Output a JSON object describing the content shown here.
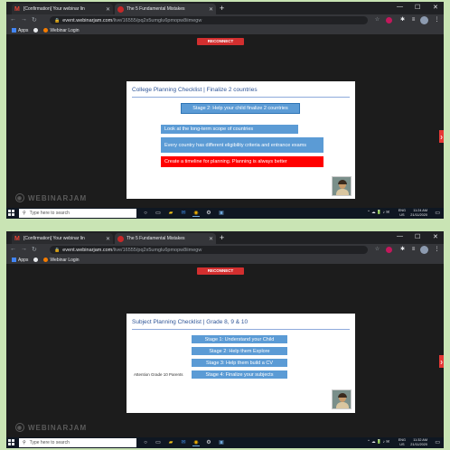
{
  "colors": {
    "page_bg": "#c9e4b4",
    "slide_title": "#2f5597",
    "bar_blue": "#5b9bd5",
    "bar_red": "#ff0000",
    "reconnect": "#d32f2f"
  },
  "screens": [
    {
      "tabs": [
        {
          "label": "[Confirmation] Your webinar lin",
          "icon": "gmail-icon"
        },
        {
          "label": "The 5 Fundamental Mistakes",
          "icon": "webinarjam-icon"
        }
      ],
      "new_tab": "+",
      "url_host": "event.webinarjam.com",
      "url_path": "/live/16555/pq2x5umglu6pmopw8iimegw",
      "bookmarks": [
        {
          "label": "Apps"
        },
        {
          "label": ""
        },
        {
          "label": "Webinar Login"
        }
      ],
      "reconnect": "RECONNECT",
      "slide": {
        "title": "College Planning Checklist | Finalize 2 countries",
        "stage": "Stage 2: Help your child finalize 2 countries",
        "items": [
          "Look at the long-term scope of countries",
          "Every country has different eligibility criteria and entrance exams",
          "Create a timeline for planning. Planning is always better"
        ]
      },
      "watermark": "WEBINARJAM",
      "taskbar": {
        "search_placeholder": "Type here to search",
        "lang_top": "ENG",
        "lang_bottom": "US",
        "time": "11:24 AM",
        "date": "21/11/2020"
      }
    },
    {
      "tabs": [
        {
          "label": "[Confirmation] Your webinar lin",
          "icon": "gmail-icon"
        },
        {
          "label": "The 5 Fundamental Mistakes",
          "icon": "webinarjam-icon"
        }
      ],
      "new_tab": "+",
      "url_host": "event.webinarjam.com",
      "url_path": "/live/16555/pq2x5umglu6pmopw8iimegw",
      "bookmarks": [
        {
          "label": "Apps"
        },
        {
          "label": ""
        },
        {
          "label": "Webinar Login"
        }
      ],
      "reconnect": "RECONNECT",
      "slide": {
        "title": "Subject Planning Checklist | Grade 8, 9 & 10",
        "stages": [
          "Stage 1: Understand your Child",
          "Stage 2: Help them Explore",
          "Stage 3: Help them build a CV",
          "Stage 4: Finalize your subjects"
        ],
        "side_note": "Attention Grade 10 Parents"
      },
      "watermark": "WEBINARJAM",
      "taskbar": {
        "search_placeholder": "Type here to search",
        "lang_top": "ENG",
        "lang_bottom": "US",
        "time": "11:32 AM",
        "date": "21/11/2020"
      }
    }
  ]
}
